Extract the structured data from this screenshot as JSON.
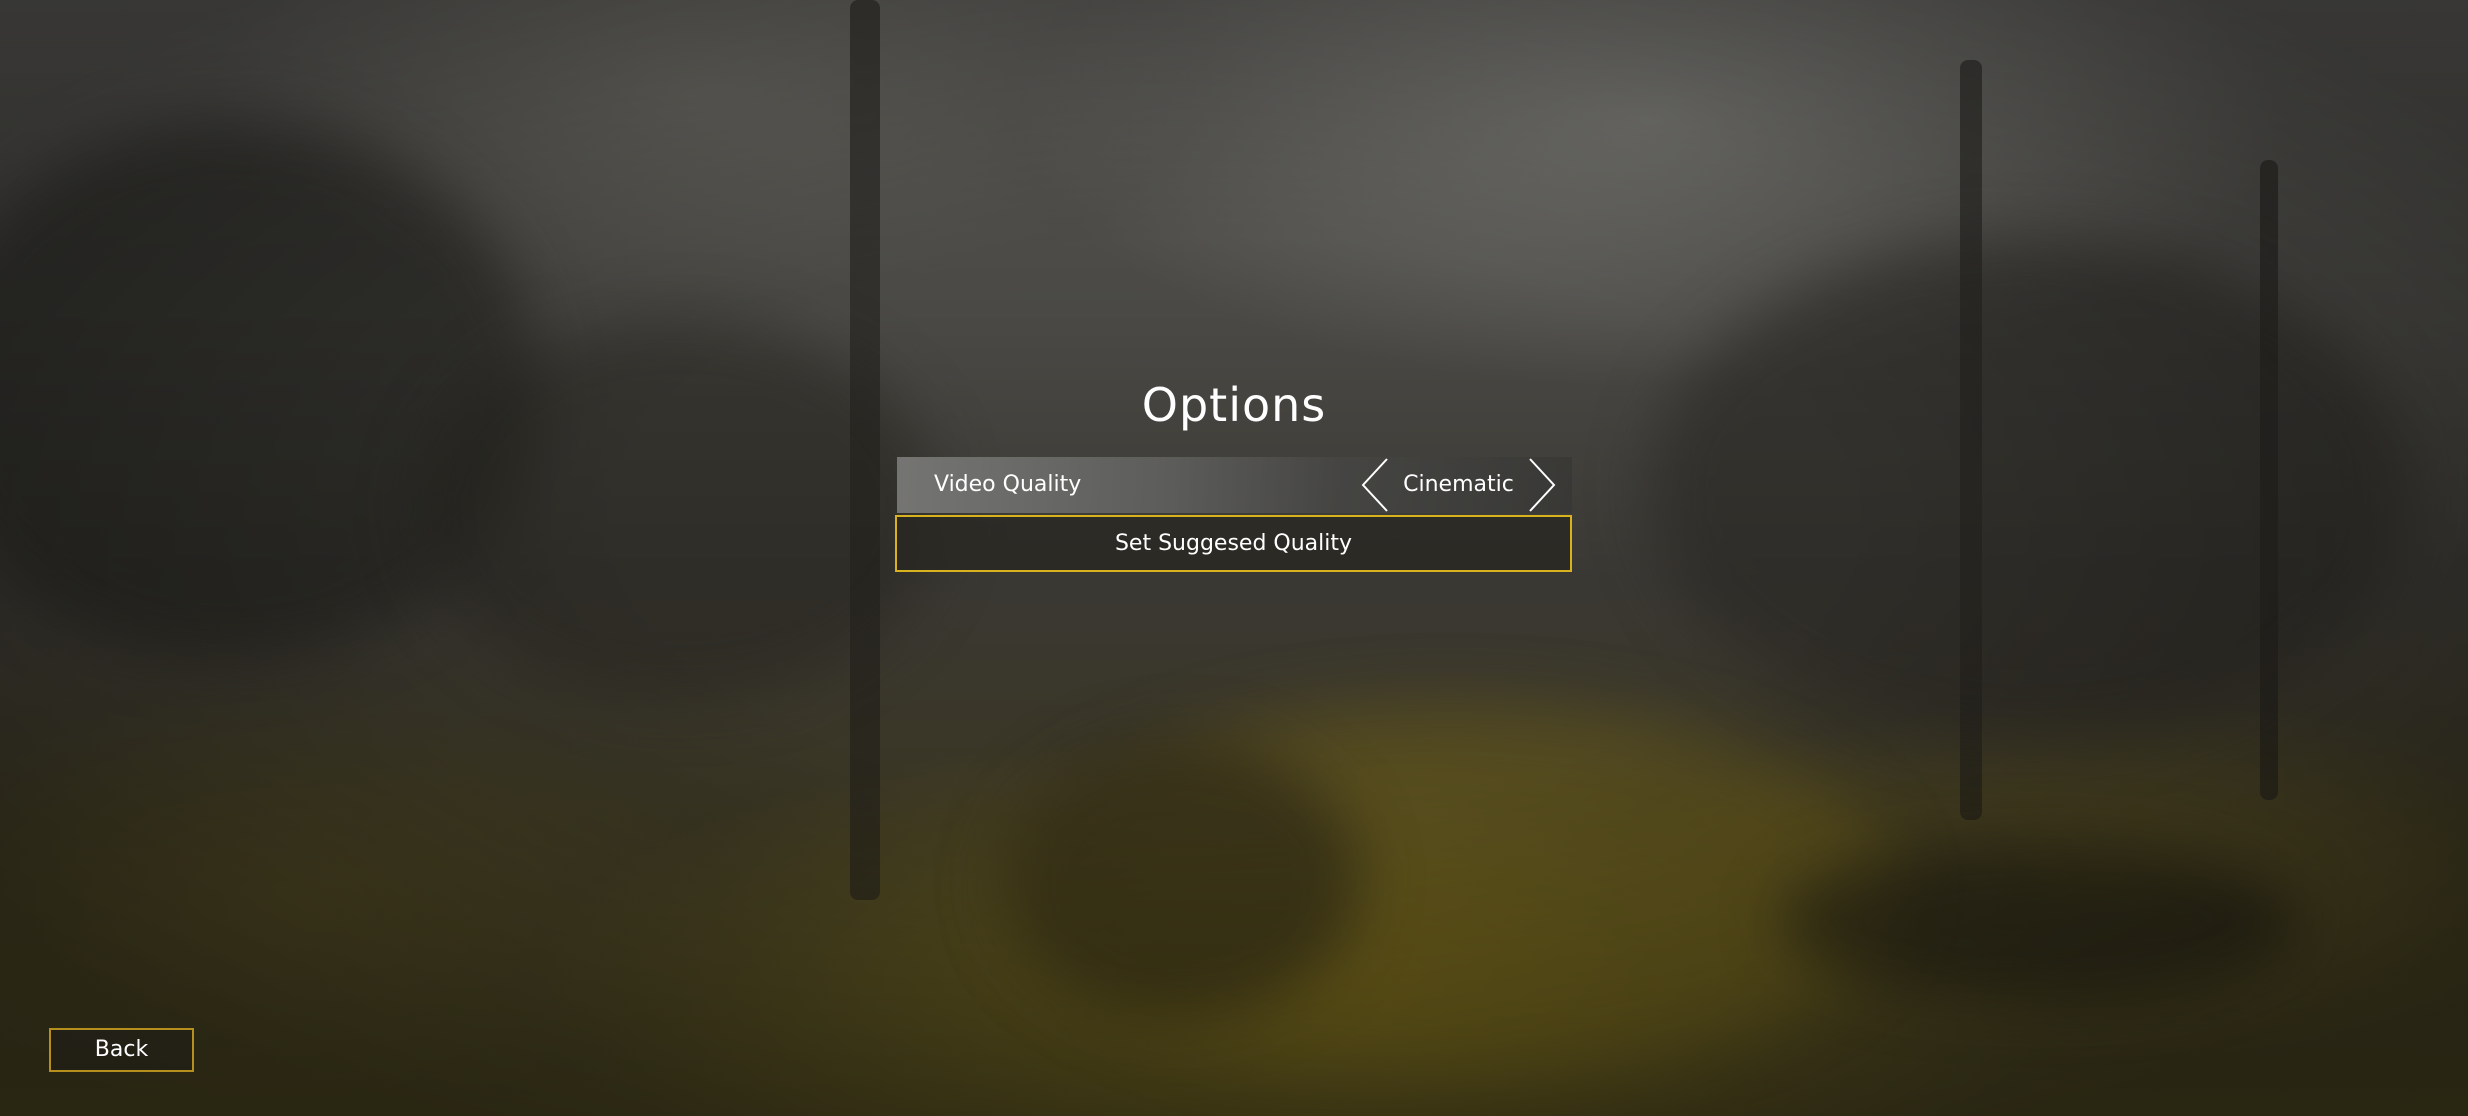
{
  "screen": {
    "title": "Options"
  },
  "video_quality": {
    "label": "Video Quality",
    "value": "Cinematic"
  },
  "buttons": {
    "set_suggested_label": "Set Suggesed Quality",
    "back_label": "Back"
  },
  "colors": {
    "accent": "#d9b21f",
    "text": "#ffffff"
  },
  "icons": {
    "left_arrow": "chevron-left-icon",
    "right_arrow": "chevron-right-icon"
  }
}
